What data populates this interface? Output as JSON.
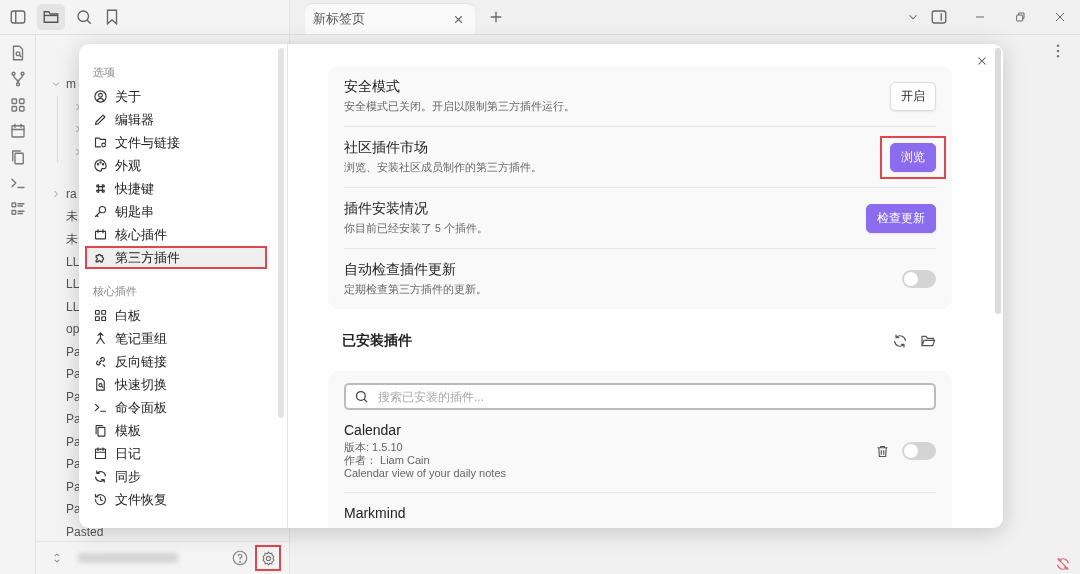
{
  "tabs": [
    {
      "label": "新标签页",
      "selected": true
    }
  ],
  "file_explorer": {
    "items": [
      {
        "label": "m",
        "kind": "folder",
        "expanded": true,
        "children": [
          {
            "kind": "folder",
            "expanded": false
          },
          {
            "kind": "folder",
            "expanded": false
          },
          {
            "kind": "folder",
            "expanded": false
          }
        ]
      },
      {
        "label": "ra",
        "kind": "folder",
        "expanded": false
      },
      {
        "label": "未",
        "kind": "file"
      },
      {
        "label": "未",
        "kind": "file"
      },
      {
        "label": "LL",
        "kind": "file"
      },
      {
        "label": "LL",
        "kind": "file"
      },
      {
        "label": "LL",
        "kind": "file"
      },
      {
        "label": "op",
        "kind": "file"
      },
      {
        "label": "Pa",
        "kind": "file"
      },
      {
        "label": "Pa",
        "kind": "file"
      },
      {
        "label": "Pa",
        "kind": "file"
      },
      {
        "label": "Pa",
        "kind": "file"
      },
      {
        "label": "Pa",
        "kind": "file"
      },
      {
        "label": "Pa",
        "kind": "file"
      },
      {
        "label": "Pa",
        "kind": "file"
      },
      {
        "label": "Pa",
        "kind": "file"
      },
      {
        "label": "Pasted",
        "kind": "file"
      }
    ],
    "footer": {
      "settings_highlighted": true
    }
  },
  "settings_modal": {
    "sidebar": [
      {
        "title": "选项",
        "items": [
          {
            "label": "关于",
            "selected": false,
            "highlighted": false
          },
          {
            "label": "编辑器",
            "selected": false,
            "highlighted": false
          },
          {
            "label": "文件与链接",
            "selected": false,
            "highlighted": false
          },
          {
            "label": "外观",
            "selected": false,
            "highlighted": false
          },
          {
            "label": "快捷键",
            "selected": false,
            "highlighted": false
          },
          {
            "label": "钥匙串",
            "selected": false,
            "highlighted": false
          },
          {
            "label": "核心插件",
            "selected": false,
            "highlighted": false
          },
          {
            "label": "第三方插件",
            "selected": true,
            "highlighted": true
          }
        ]
      },
      {
        "title": "核心插件",
        "items": [
          {
            "label": "白板",
            "selected": false,
            "highlighted": false
          },
          {
            "label": "笔记重组",
            "selected": false,
            "highlighted": false
          },
          {
            "label": "反向链接",
            "selected": false,
            "highlighted": false
          },
          {
            "label": "快速切换",
            "selected": false,
            "highlighted": false
          },
          {
            "label": "命令面板",
            "selected": false,
            "highlighted": false
          },
          {
            "label": "模板",
            "selected": false,
            "highlighted": false
          },
          {
            "label": "日记",
            "selected": false,
            "highlighted": false
          },
          {
            "label": "同步",
            "selected": false,
            "highlighted": false
          },
          {
            "label": "文件恢复",
            "selected": false,
            "highlighted": false
          }
        ]
      }
    ],
    "settings": [
      {
        "title": "安全模式",
        "description": "安全模式已关闭。开启以限制第三方插件运行。",
        "control": {
          "kind": "button",
          "label": "开启",
          "primary": false,
          "highlighted": false
        }
      },
      {
        "title": "社区插件市场",
        "description": "浏览、安装社区成员制作的第三方插件。",
        "control": {
          "kind": "button",
          "label": "浏览",
          "primary": true,
          "highlighted": true
        }
      },
      {
        "title": "插件安装情况",
        "description": "你目前已经安装了 5 个插件。",
        "control": {
          "kind": "button",
          "label": "检查更新",
          "primary": true,
          "highlighted": false
        }
      },
      {
        "title": "自动检查插件更新",
        "description": "定期检查第三方插件的更新。",
        "control": {
          "kind": "toggle",
          "on": false
        }
      }
    ],
    "installed": {
      "title": "已安装插件",
      "search": {
        "placeholder": "搜索已安装的插件..."
      },
      "plugins": [
        {
          "name": "Calendar",
          "version": "版本: 1.5.10",
          "author": "作者： Liam Cain",
          "description": "Calendar view of your daily notes",
          "enabled": false
        },
        {
          "name": "Markmind"
        }
      ]
    }
  }
}
